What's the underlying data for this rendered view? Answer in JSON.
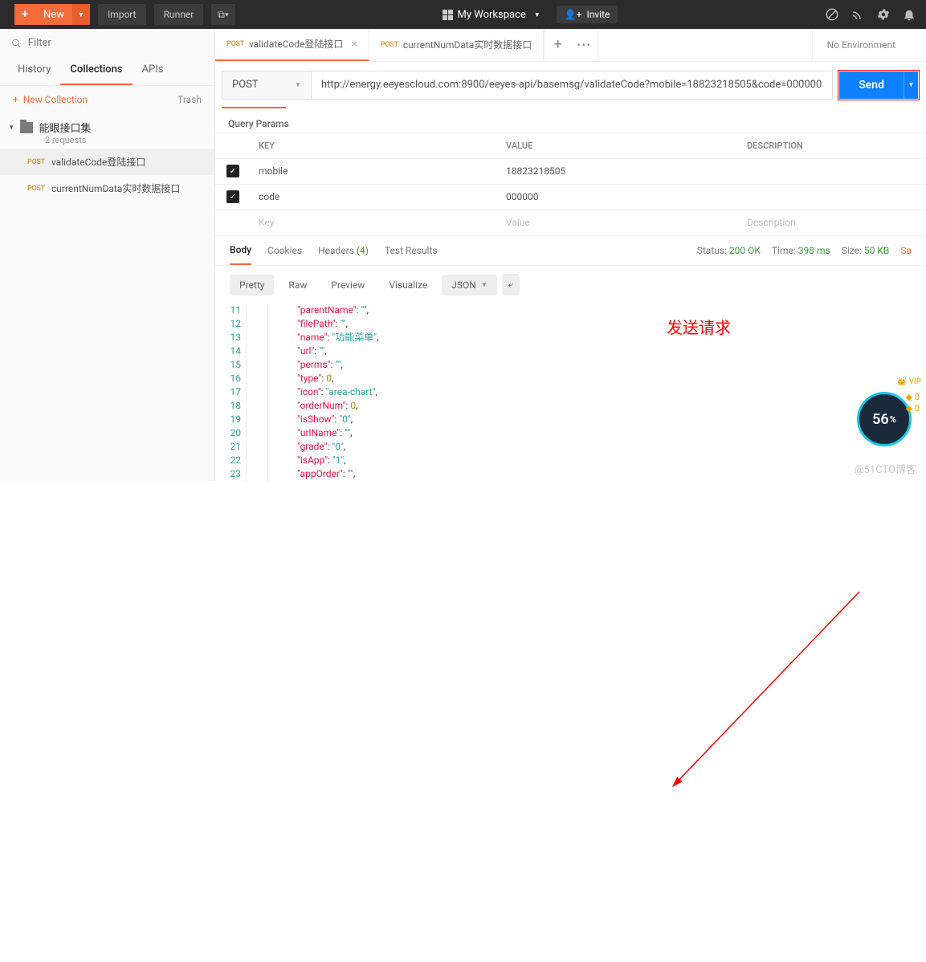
{
  "topbar": {
    "new_label": "New",
    "import_label": "Import",
    "runner_label": "Runner",
    "workspace_label": "My Workspace",
    "invite_label": "Invite"
  },
  "sidebar": {
    "filter_placeholder": "Filter",
    "tabs": {
      "history": "History",
      "collections": "Collections",
      "apis": "APIs"
    },
    "new_collection": "New Collection",
    "trash": "Trash",
    "collection": {
      "name": "能眼接口集",
      "sub": "2 requests"
    },
    "items": [
      {
        "method": "POST",
        "name": "validateCode登陆接口"
      },
      {
        "method": "POST",
        "name": "currentNumData实时数据接口"
      }
    ]
  },
  "tabs": {
    "t0": {
      "method": "POST",
      "name": "validateCode登陆接口"
    },
    "t1": {
      "method": "POST",
      "name": "currentNumData实时数据接口"
    }
  },
  "env_label": "No Environment",
  "request": {
    "method": "POST",
    "url": "http://energy.eeyescloud.com:8900/eeyes-api/basemsg/validateCode?mobile=18823218505&code=000000",
    "send": "Send"
  },
  "qp": {
    "title": "Query Params",
    "headers": {
      "key": "KEY",
      "value": "VALUE",
      "desc": "DESCRIPTION"
    },
    "rows": [
      {
        "key": "mobile",
        "value": "18823218505"
      },
      {
        "key": "code",
        "value": "000000"
      }
    ],
    "ph": {
      "key": "Key",
      "value": "Value",
      "desc": "Description"
    }
  },
  "resp": {
    "tabs": {
      "body": "Body",
      "cookies": "Cookies",
      "headers": "Headers",
      "hcount": "(4)",
      "test": "Test Results"
    },
    "status_label": "Status:",
    "status": "200 OK",
    "time_label": "Time:",
    "time": "398 ms",
    "size_label": "Size:",
    "size": "50 KB",
    "save": "Sa",
    "view": {
      "pretty": "Pretty",
      "raw": "Raw",
      "preview": "Preview",
      "visualize": "Visualize",
      "fmt": "JSON"
    }
  },
  "json_lines": {
    "start": 11,
    "lines": [
      {
        "k": "parentName",
        "v": "\"\"",
        "t": "s"
      },
      {
        "k": "filePath",
        "v": "\"\"",
        "t": "s"
      },
      {
        "k": "name",
        "v": "\"功能菜单\"",
        "t": "s"
      },
      {
        "k": "url",
        "v": "\"\"",
        "t": "s"
      },
      {
        "k": "perms",
        "v": "\"\"",
        "t": "s"
      },
      {
        "k": "type",
        "v": "0",
        "t": "n"
      },
      {
        "k": "icon",
        "v": "\"area-chart\"",
        "t": "s"
      },
      {
        "k": "orderNum",
        "v": "0",
        "t": "n"
      },
      {
        "k": "isShow",
        "v": "\"0\"",
        "t": "s"
      },
      {
        "k": "urlName",
        "v": "\"\"",
        "t": "s"
      },
      {
        "k": "grade",
        "v": "\"0\"",
        "t": "s"
      },
      {
        "k": "isApp",
        "v": "\"1\"",
        "t": "s"
      },
      {
        "k": "appOrder",
        "v": "\"\"",
        "t": "s"
      }
    ]
  },
  "annot": "发送请求",
  "badge": "56",
  "watermark": "@51CTO博客"
}
